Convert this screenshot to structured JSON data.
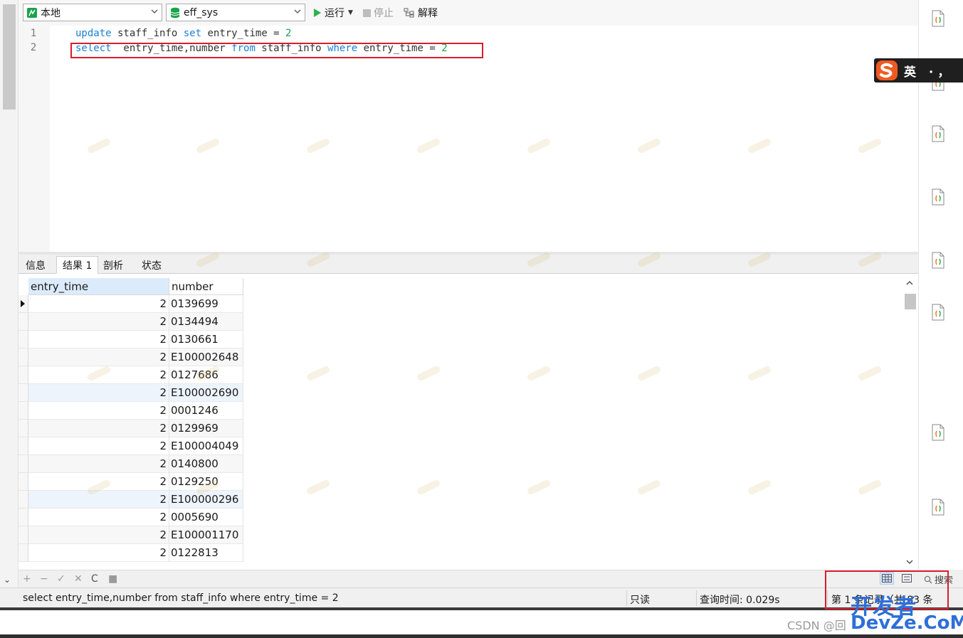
{
  "toolbar": {
    "connection": "本地",
    "database": "eff_sys",
    "run_label": "运行",
    "stop_label": "停止",
    "explain_label": "解释"
  },
  "editor": {
    "line_numbers": [
      "1",
      "2"
    ],
    "line1": {
      "k1": "update",
      "t1": " staff_info ",
      "k2": "set",
      "t2": " entry_time = ",
      "n": "2"
    },
    "line2": {
      "k1": "select",
      "t1": "  entry_time,number ",
      "k2": "from",
      "t2": " staff_info ",
      "k3": "where",
      "t3": " entry_time = ",
      "n": "2"
    }
  },
  "tabs": [
    {
      "label": "信息"
    },
    {
      "label": "结果 1"
    },
    {
      "label": "剖析"
    },
    {
      "label": "状态"
    }
  ],
  "grid": {
    "columns": [
      "entry_time",
      "number"
    ],
    "rows": [
      [
        "2",
        "0139699"
      ],
      [
        "2",
        "0134494"
      ],
      [
        "2",
        "0130661"
      ],
      [
        "2",
        "E100002648"
      ],
      [
        "2",
        "0127686"
      ],
      [
        "2",
        "E100002690"
      ],
      [
        "2",
        "0001246"
      ],
      [
        "2",
        "0129969"
      ],
      [
        "2",
        "E100004049"
      ],
      [
        "2",
        "0140800"
      ],
      [
        "2",
        "0129250"
      ],
      [
        "2",
        "E100000296"
      ],
      [
        "2",
        "0005690"
      ],
      [
        "2",
        "E100001170"
      ],
      [
        "2",
        "0122813"
      ]
    ]
  },
  "grid_tools": {
    "add": "+",
    "remove": "−",
    "apply": "✓",
    "discard": "✕",
    "refresh": "C",
    "stop": "■",
    "search": "搜索"
  },
  "status": {
    "sql": "select  entry_time,number from staff_info where entry_time = 2",
    "mode": "只读",
    "query_time": "查询时间: 0.029s",
    "records": "第 1 条记录（共 83 条"
  },
  "ime": {
    "label": "英 ·，"
  },
  "watermarks": {
    "site": "开发者",
    "site2": "DevZe.CoM",
    "csdn": "CSDN @回"
  },
  "colors": {
    "keyword": "#1a7fd4",
    "number": "#19a34a",
    "highlight": "#d81e2c",
    "accent": "#2f6fd8"
  }
}
